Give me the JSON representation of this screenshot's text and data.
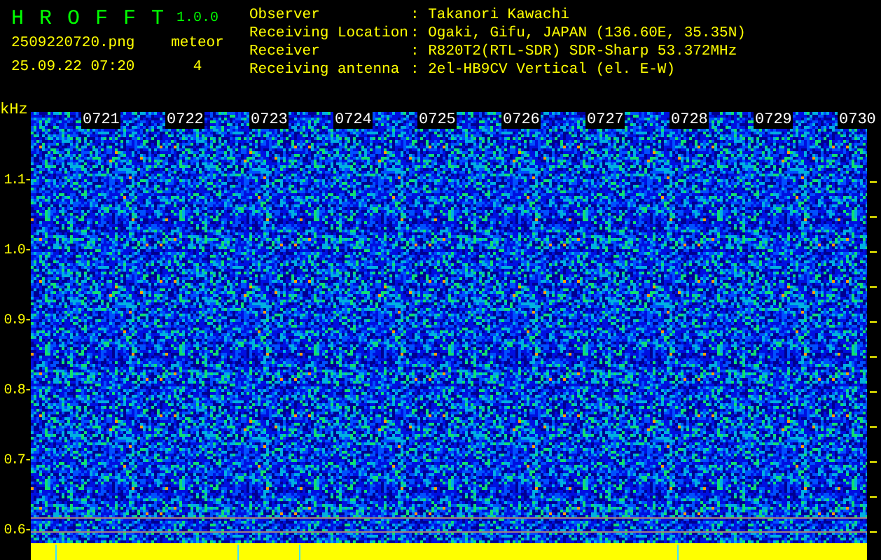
{
  "app": {
    "title": "H R O F F T",
    "version": "1.0.0"
  },
  "capture": {
    "filename": "2509220720.png",
    "datetime": "25.09.22 07:20",
    "meteor_label": "meteor",
    "meteor_count": "4"
  },
  "station_info": [
    {
      "label": "Observer",
      "value": ": Takanori Kawachi"
    },
    {
      "label": "Receiving Location",
      "value": ": Ogaki, Gifu, JAPAN (136.60E, 35.35N)"
    },
    {
      "label": "Receiver",
      "value": ": R820T2(RTL-SDR) SDR-Sharp 53.372MHz"
    },
    {
      "label": "Receiving antenna",
      "value": ": 2el-HB9CV Vertical (el. E-W)"
    }
  ],
  "spectrogram": {
    "unit": "kHz",
    "frequency_labels": [
      "1.1-",
      "1.0-",
      "0.9-",
      "0.8-",
      "0.7-",
      "0.6-"
    ],
    "time_labels": [
      "0721",
      "0722",
      "0723",
      "0724",
      "0725",
      "0726",
      "0727",
      "0728",
      "0729",
      "0730"
    ]
  }
}
